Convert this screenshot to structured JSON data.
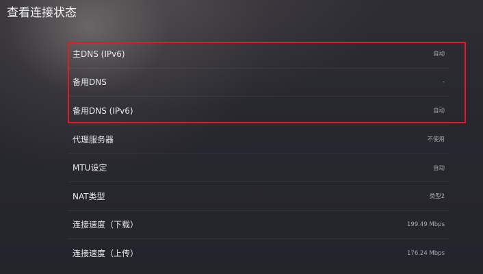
{
  "header": {
    "title": "查看连接状态"
  },
  "settings": [
    {
      "label": "主DNS (IPv6)",
      "value": "自动"
    },
    {
      "label": "备用DNS",
      "value": "-"
    },
    {
      "label": "备用DNS (IPv6)",
      "value": "自动"
    },
    {
      "label": "代理服务器",
      "value": "不使用"
    },
    {
      "label": "MTU设定",
      "value": "自动"
    },
    {
      "label": "NAT类型",
      "value": "类型2"
    },
    {
      "label": "连接速度（下载）",
      "value": "199.49 Mbps"
    },
    {
      "label": "连接速度（上传）",
      "value": "176.24 Mbps"
    }
  ],
  "highlight": {
    "color": "#e21b2a"
  }
}
